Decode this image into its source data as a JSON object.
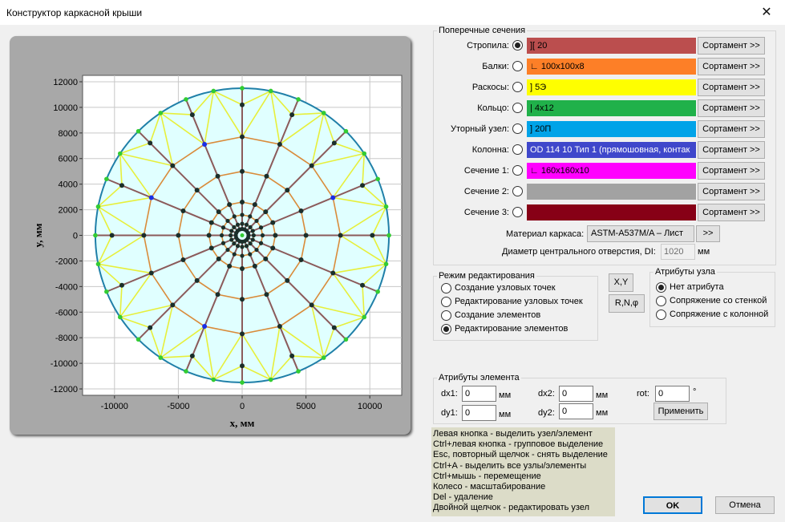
{
  "window": {
    "title": "Конструктор каркасной крыши",
    "close_glyph": "✕"
  },
  "plot": {
    "xlabel": "x, мм",
    "ylabel": "y, мм",
    "xticks": [
      "-10000",
      "-5000",
      "0",
      "5000",
      "10000"
    ],
    "yticks": [
      "12000",
      "10000",
      "8000",
      "6000",
      "4000",
      "2000",
      "0",
      "-2000",
      "-4000",
      "-6000",
      "-8000",
      "-10000",
      "-12000"
    ],
    "colors": {
      "fill": "#e0ffff",
      "outer": "#1f7fa8",
      "rafter": "#8b5a5a",
      "beam": "#d98b3a",
      "brace": "#e7ef3a",
      "node_dark": "#1a2e2a",
      "node_green": "#33cc33",
      "node_blue": "#1a2ee6"
    }
  },
  "chart_data": {
    "type": "scatter",
    "title": "",
    "xlabel": "x, мм",
    "ylabel": "y, мм",
    "xlim": [
      -12500,
      12500
    ],
    "ylim": [
      -12500,
      12500
    ],
    "grid": true,
    "outer_radius": 11500,
    "rafter_count": 16,
    "rafter_node_radii": [
      10200,
      7700,
      5000,
      2600,
      1600,
      900,
      500
    ],
    "outer_node_radius": 11500,
    "brace_node_radius": 11500,
    "hub_radius": 510
  },
  "sections": {
    "legend": "Поперечные сечения",
    "rows": [
      {
        "label": "Стропила:",
        "value": "][ 20",
        "color": "#bb4e4e",
        "selected": true
      },
      {
        "label": "Балки:",
        "value": "∟ 100x100x8",
        "color": "#fd7f27",
        "selected": false
      },
      {
        "label": "Раскосы:",
        "value": "] 5Э",
        "color": "#fefe00",
        "selected": false
      },
      {
        "label": "Кольцо:",
        "value": "| 4x12",
        "color": "#20b14a",
        "selected": false
      },
      {
        "label": "Уторный узел:",
        "value": "] 20П",
        "color": "#00a3e8",
        "selected": false
      },
      {
        "label": "Колонна:",
        "value": "OD 114  10  Тип 1 (прямошовная, контак",
        "color": "#3f47cb",
        "selected": false
      },
      {
        "label": "Сечение 1:",
        "value": "∟ 160x160x10",
        "color": "#ff00fe",
        "selected": false
      },
      {
        "label": "Сечение 2:",
        "value": "",
        "color": "#a2a2a2",
        "selected": false
      },
      {
        "label": "Сечение 3:",
        "value": "",
        "color": "#870016",
        "selected": false
      }
    ],
    "sort_label": "Сортамент >>",
    "material_label": "Материал каркаса:",
    "material_value": "ASTM-A537M/A – Лист",
    "material_btn": ">>",
    "diameter_label": "Диаметр центрального отверстия, DI:",
    "diameter_value": "1020",
    "diameter_unit": "мм"
  },
  "edit_mode": {
    "legend": "Режим редактирования",
    "options": [
      {
        "label": "Создание узловых точек",
        "selected": false
      },
      {
        "label": "Редактирование узловых точек",
        "selected": false
      },
      {
        "label": "Создание элементов",
        "selected": false
      },
      {
        "label": "Редактирование элементов",
        "selected": true
      }
    ],
    "btn_xy": "X,Y",
    "btn_rnf": "R,N,φ"
  },
  "node_attrs": {
    "legend": "Атрибуты узла",
    "options": [
      {
        "label": "Нет атрибута",
        "selected": true
      },
      {
        "label": "Сопряжение со стенкой",
        "selected": false
      },
      {
        "label": "Сопряжение с колонной",
        "selected": false
      }
    ]
  },
  "elem_attrs": {
    "legend": "Атрибуты элемента",
    "dx1_label": "dx1:",
    "dx1": "0",
    "dy1_label": "dy1:",
    "dy1": "0",
    "dx2_label": "dx2:",
    "dx2": "0",
    "dy2_label": "dy2:",
    "dy2": "0",
    "rot_label": "rot:",
    "rot": "0",
    "unit_mm": "мм",
    "unit_deg": "°",
    "apply": "Применить"
  },
  "help": [
    "Левая кнопка - выделить узел/элемент",
    "Ctrl+левая кнопка - групповое выделение",
    "Esc, повторный щелчок - снять выделение",
    "Ctrl+A - выделить все узлы/элементы",
    "Ctrl+мышь - перемещение",
    "Колесо - масштабирование",
    "Del - удаление",
    "Двойной щелчок - редактировать узел"
  ],
  "footer": {
    "ok": "OK",
    "cancel": "Отмена"
  }
}
